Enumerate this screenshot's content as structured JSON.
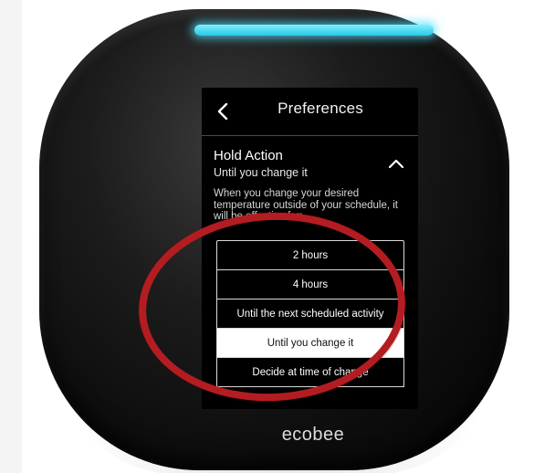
{
  "device": {
    "brand": "ecobee",
    "led_color": "#3fd6f2"
  },
  "header": {
    "title": "Preferences",
    "back_icon": "chevron-left-icon"
  },
  "section": {
    "title": "Hold Action",
    "current_value": "Until you change it",
    "toggle_icon": "chevron-up-icon",
    "description": "When you change your desired temperature outside of your schedule, it will be effective for:"
  },
  "options": [
    {
      "label": "2 hours",
      "selected": false
    },
    {
      "label": "4 hours",
      "selected": false
    },
    {
      "label": "Until the next scheduled activity",
      "selected": false
    },
    {
      "label": "Until you change it",
      "selected": true
    },
    {
      "label": "Decide at time of change",
      "selected": false
    }
  ],
  "annotation": {
    "shape": "ellipse",
    "color": "#b31d21"
  }
}
